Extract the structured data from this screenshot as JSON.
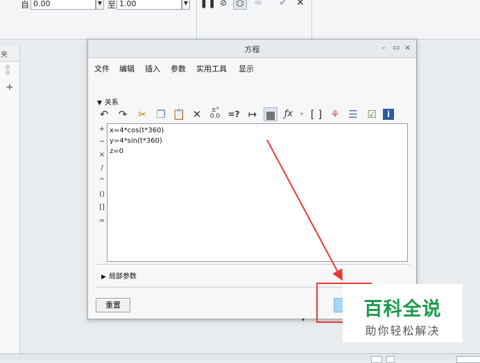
{
  "toolbar": {
    "from_label": "自",
    "from_value": "0.00",
    "to_label": "至",
    "to_value": "1.00",
    "icons": [
      "pause-icon",
      "stop-icon",
      "preview-icon",
      "glasses-icon",
      "check-icon",
      "close-icon"
    ]
  },
  "left_panel": {
    "tab_label": "夹"
  },
  "dialog": {
    "title": "方程",
    "window_buttons": [
      "–",
      "▭",
      "×"
    ],
    "menu": [
      "文件",
      "编辑",
      "插入",
      "参数",
      "实用工具",
      "显示"
    ],
    "relations_label": "关系",
    "operators": [
      "+",
      "−",
      "×",
      "/",
      "^",
      "()",
      "[]",
      "="
    ],
    "equations": [
      "x=4*cos(t*360)",
      "y=4*sin(t*360)",
      "z=0"
    ],
    "local_params_label": "局部参数",
    "reset_label": "重置"
  },
  "watermark": {
    "main": "百科全说",
    "sub": "助你轻松解决"
  },
  "colors": {
    "annotation": "#e53935",
    "watermark_green": "#1a9a4a",
    "ok_button": "#a9d8f4"
  }
}
